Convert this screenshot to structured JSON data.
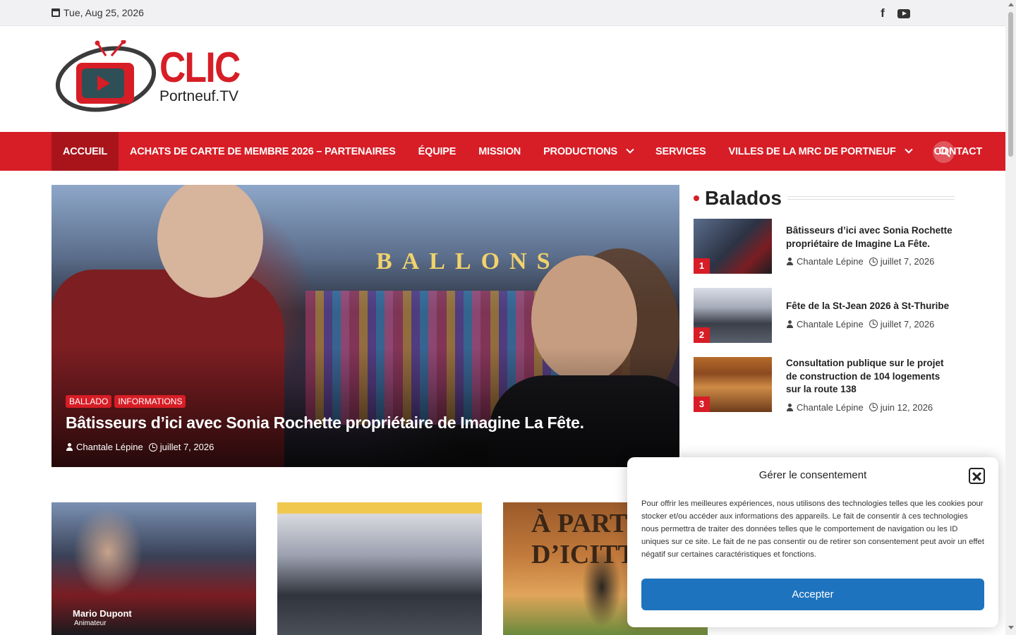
{
  "topbar": {
    "date": "Tue, Aug 25, 2026",
    "icons": [
      "calendar-icon",
      "facebook-icon",
      "youtube-icon"
    ]
  },
  "logo": {
    "main": "CLIC",
    "sub": "Portneuf.TV"
  },
  "colors": {
    "brand_red": "#d71d26",
    "active_red": "#a9141b",
    "accept_blue": "#1e73be"
  },
  "nav": {
    "items": [
      {
        "label": "ACCUEIL"
      },
      {
        "label": "ACHATS DE CARTE DE MEMBRE 2026 – PARTENAIRES"
      },
      {
        "label": "ÉQUIPE"
      },
      {
        "label": "MISSION"
      },
      {
        "label": "PRODUCTIONS"
      },
      {
        "label": "SERVICES"
      },
      {
        "label": "VILLES DE LA MRC DE PORTNEUF"
      },
      {
        "label": "CONTACT"
      }
    ],
    "active_index": 0
  },
  "hero": {
    "sign": "BALLONS",
    "categories": [
      "BALLADO",
      "INFORMATIONS"
    ],
    "title": "Bâtisseurs d’ici avec Sonia Rochette propriétaire de Imagine La Fête.",
    "author": "Chantale Lépine",
    "date": "juillet 7, 2026"
  },
  "sidebar": {
    "title": "Balados",
    "items": [
      {
        "num": "1",
        "title": "Bâtisseurs d’ici avec Sonia Rochette propriétaire de Imagine La Fête.",
        "author": "Chantale Lépine",
        "date": "juillet 7, 2026"
      },
      {
        "num": "2",
        "title": "Fête de la St-Jean 2026 à St-Thuribe",
        "author": "Chantale Lépine",
        "date": "juillet 7, 2026"
      },
      {
        "num": "3",
        "title": "Consultation publique sur le projet de construction de 104 logements sur la route 138",
        "author": "Chantale Lépine",
        "date": "juin 12, 2026"
      }
    ]
  },
  "cards": {
    "a_caption": "Mario Dupont",
    "a_caption2": "Animateur",
    "c_sign": "À PARTIR D’ICITTE"
  },
  "consent": {
    "title": "Gérer le consentement",
    "body": "Pour offrir les meilleures expériences, nous utilisons des technologies telles que les cookies pour stocker et/ou accéder aux informations des appareils. Le fait de consentir à ces technologies nous permettra de traiter des données telles que le comportement de navigation ou les ID uniques sur ce site. Le fait de ne pas consentir ou de retirer son consentement peut avoir un effet négatif sur certaines caractéristiques et fonctions.",
    "accept": "Accepter"
  }
}
